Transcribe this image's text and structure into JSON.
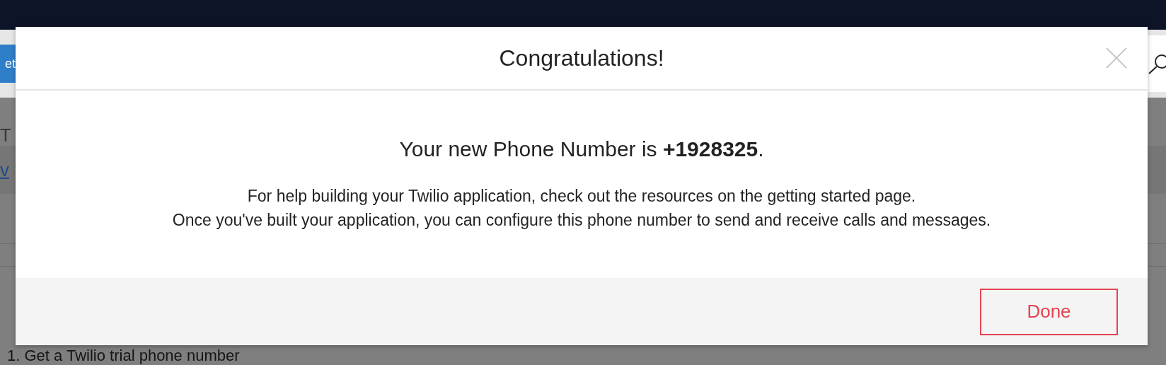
{
  "background": {
    "toolbar_button": "et",
    "section_label": "T",
    "link": "v",
    "step_heading": "1. Get a Twilio trial phone number"
  },
  "dialog": {
    "title": "Congratulations!",
    "headline": "Your new Phone Number is **+1928325**.",
    "paragraphs": [
      "For help building your Twilio application, check out the resources on the getting started page.",
      "Once you've built your application, you can configure this phone number to send and receive calls and messages."
    ],
    "buttons": [
      "Done"
    ]
  }
}
